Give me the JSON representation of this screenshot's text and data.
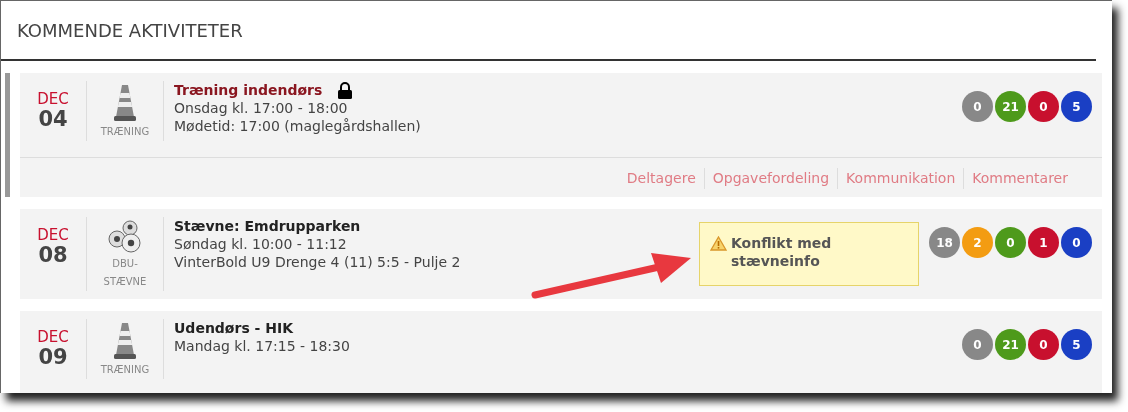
{
  "heading": "KOMMENDE AKTIVITETER",
  "activities": [
    {
      "month": "DEC",
      "day": "04",
      "kind": "cone",
      "category": "TRÆNING",
      "title": "Træning indendørs",
      "locked": true,
      "selected": true,
      "details": [
        "Onsdag kl. 17:00 - 18:00",
        "Mødetid: 17:00 (maglegårdshallen)"
      ],
      "counts": [
        {
          "value": "0",
          "color": "#888888"
        },
        {
          "value": "21",
          "color": "#4e9a1b"
        },
        {
          "value": "0",
          "color": "#c8102e"
        },
        {
          "value": "5",
          "color": "#1a3fc4"
        }
      ],
      "links": [
        "Deltagere",
        "Opgavefordeling",
        "Kommunikation",
        "Kommentarer"
      ]
    },
    {
      "month": "DEC",
      "day": "08",
      "kind": "balls",
      "category": "DBU-STÆVNE",
      "title": "Stævne: Emdrupparken",
      "locked": false,
      "selected": false,
      "details": [
        "Søndag kl. 10:00 - 11:12",
        "VinterBold U9 Drenge 4 (11) 5:5 - Pulje 2"
      ],
      "warning": "Konflikt med stævneinfo",
      "counts": [
        {
          "value": "18",
          "color": "#888888"
        },
        {
          "value": "2",
          "color": "#f39c12"
        },
        {
          "value": "0",
          "color": "#4e9a1b"
        },
        {
          "value": "1",
          "color": "#c8102e"
        },
        {
          "value": "0",
          "color": "#1a3fc4"
        }
      ]
    },
    {
      "month": "DEC",
      "day": "09",
      "kind": "cone",
      "category": "TRÆNING",
      "title": "Udendørs - HIK",
      "locked": false,
      "selected": false,
      "details": [
        "Mandag kl. 17:15 - 18:30"
      ],
      "counts": [
        {
          "value": "0",
          "color": "#888888"
        },
        {
          "value": "21",
          "color": "#4e9a1b"
        },
        {
          "value": "0",
          "color": "#c8102e"
        },
        {
          "value": "5",
          "color": "#1a3fc4"
        }
      ]
    }
  ]
}
